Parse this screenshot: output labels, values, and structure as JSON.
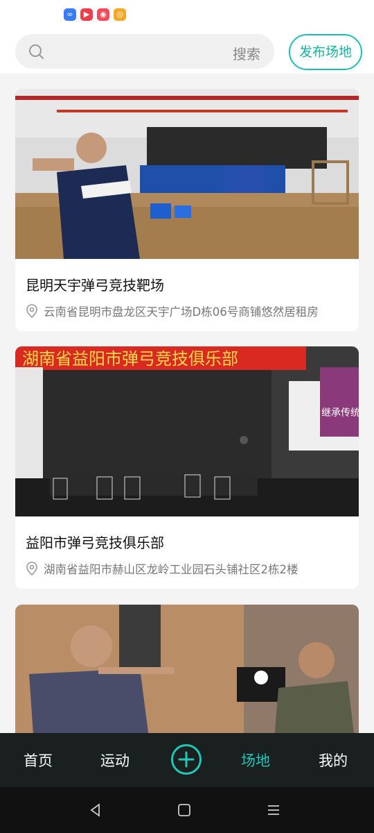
{
  "status_bar": {
    "notification_icons": [
      {
        "name": "infinity-app-icon",
        "glyph": "∞",
        "color": "#3a7cf5"
      },
      {
        "name": "video-app-icon",
        "glyph": "▶",
        "color": "#ef3d4a"
      },
      {
        "name": "camera-app-icon",
        "glyph": "◉",
        "color": "#f24a5b"
      },
      {
        "name": "weibo-icon",
        "glyph": "◎",
        "color": "#f5a623"
      }
    ]
  },
  "search": {
    "label": "搜索"
  },
  "header": {
    "publish_label": "发布场地"
  },
  "venues": [
    {
      "title": "昆明天宇弹弓竞技靶场",
      "address": "云南省昆明市盘龙区天宇广场D栋06号商铺悠然居租房"
    },
    {
      "title": "益阳市弹弓竞技俱乐部",
      "address": "湖南省益阳市赫山区龙岭工业园石头铺社区2栋2楼",
      "banner": "湖南省益阳市弹弓竞技俱乐部",
      "side_banner": "继承传统"
    },
    {
      "title": "",
      "address": ""
    }
  ],
  "tabs": [
    {
      "label": "首页"
    },
    {
      "label": "运动"
    },
    {
      "label": "场地"
    },
    {
      "label": "我的"
    }
  ],
  "colors": {
    "accent": "#19c2b0",
    "tabbar_bg": "#1a1f1f"
  }
}
